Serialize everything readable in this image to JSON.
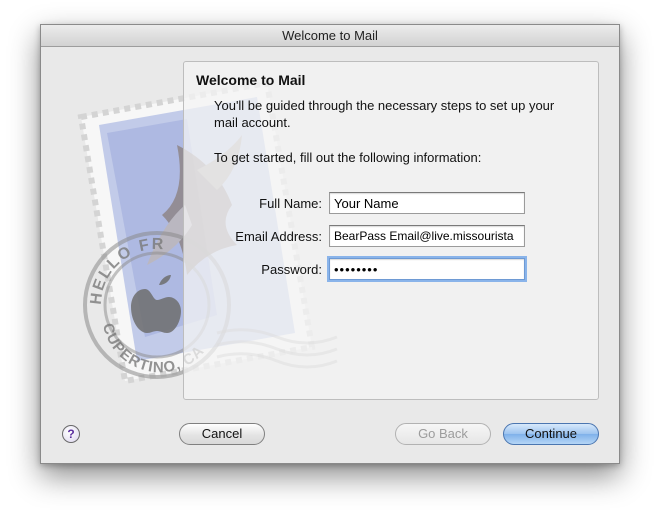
{
  "window": {
    "title": "Welcome to Mail"
  },
  "stamp": {
    "postmark_top": "HELLO FR",
    "postmark_bottom": "CUPERTINO, CA"
  },
  "panel": {
    "heading": "Welcome to Mail",
    "description": "You'll be guided through the necessary steps to set up your mail account.",
    "instruction": "To get started, fill out the following information:"
  },
  "form": {
    "full_name": {
      "label": "Full Name:",
      "value": "Your Name"
    },
    "email": {
      "label": "Email Address:",
      "value": "BearPass Email@live.missourista"
    },
    "password": {
      "label": "Password:",
      "value": "••••••••"
    }
  },
  "buttons": {
    "help": "?",
    "cancel": "Cancel",
    "go_back": "Go Back",
    "continue": "Continue"
  },
  "colors": {
    "accent": "#7fb1ea",
    "focus_ring": "#8ab4ea",
    "help_glyph": "#5a2d9e"
  }
}
